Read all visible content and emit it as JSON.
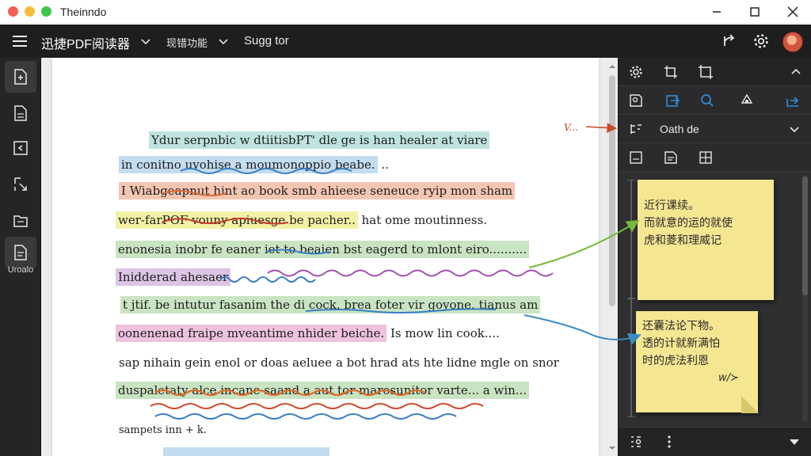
{
  "window": {
    "title": "Theinndo"
  },
  "app": {
    "name": "迅捷PDF阅读器",
    "menu_tools": "现错功能",
    "menu_suggest": "Sugg tor"
  },
  "left_toolbar": {
    "items": [
      {
        "icon": "add-file-icon",
        "active": true
      },
      {
        "icon": "document-icon",
        "active": false
      },
      {
        "icon": "import-icon",
        "active": false
      },
      {
        "icon": "select-icon",
        "active": false
      },
      {
        "icon": "folder-icon",
        "active": false
      },
      {
        "icon": "note-icon",
        "active": true
      }
    ],
    "active_label": "Uroalo"
  },
  "document": {
    "lines": [
      {
        "text": "Ydur serpnbic w dtiitisbPT'  dle ge is han healer at viare",
        "highlight": "teal"
      },
      {
        "text": "in conitno uvohise a moumonoppio beabe.",
        "highlight": "blue",
        "trail": "  .."
      },
      {
        "text": "I Wiabgeapnut hint ao book smb ahieese seneuce ryip mon sham",
        "highlight": "orange"
      },
      {
        "text": "wer-farPOF vouny apiuesge be pacher..",
        "highlight": "yellow",
        "trail": " hat ome moutinness."
      },
      {
        "text": "enonesia inobr fe eaner iet to beaien bst eagerd to mlont eiro..........",
        "highlight": "green"
      },
      {
        "text": "Inidderad ahesaer",
        "highlight": "purple"
      },
      {
        "text": "t jtif. be intutur fasanim the di cock. brea foter vir goyone. tianus am",
        "highlight": "green-partial"
      },
      {
        "text": "oonenenad fraipe mveantime nhider beiche.",
        "highlight": "pink",
        "trail": "  Is mow lin cook...."
      },
      {
        "text": "sap nihain gein enol or doas aeluee a bot hrad ats hte lidne mgle on  snor",
        "highlight": "green-partial"
      },
      {
        "text": "duspaletaty alce incane saand a aut tor marosunitor varte... a win...",
        "highlight": "green"
      },
      {
        "text": "sampets inn + k.",
        "highlight": "none"
      }
    ],
    "page_scroll_fraction": 0.0
  },
  "right_panel": {
    "dropdown_label": "Oath de",
    "sticky_notes": [
      {
        "lines": [
          "近行课续。",
          "而就意的运的就使",
          "虎和菱和理威记"
        ]
      },
      {
        "lines": [
          "还囊法论下物。",
          "透的计就新满怕",
          "时的虎法利恩"
        ],
        "signature": "w/≻"
      }
    ]
  },
  "annotation": {
    "margin_mark": "V..."
  },
  "colors": {
    "app_bar": "#1e1e1e",
    "accent_blue": "#2f8fd8",
    "sticky": "#f5e692",
    "arrow_green": "#78b83a",
    "arrow_blue": "#3b8cc2",
    "arrow_red": "#c94a2a"
  }
}
